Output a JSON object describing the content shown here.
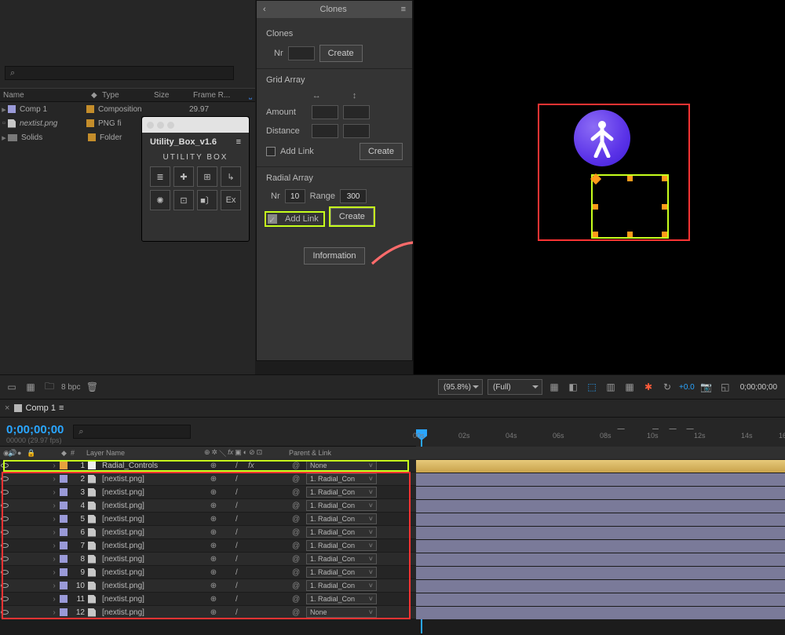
{
  "projectPanel": {
    "searchIcon": "⌕",
    "headers": {
      "name": "Name",
      "type": "Type",
      "size": "Size",
      "frame": "Frame R..."
    },
    "rows": [
      {
        "name": "Comp 1",
        "type": "Composition",
        "frame": "29.97"
      },
      {
        "name": "nextist.png",
        "type": "PNG fi"
      },
      {
        "name": "Solids",
        "type": "Folder"
      }
    ],
    "bpc": "8 bpc"
  },
  "utilityBox": {
    "title": "Utility_Box_v1.6",
    "brand": "UTILITY BOX",
    "icons": [
      "≣",
      "✚",
      "⊞",
      "↳",
      "✺",
      "⊡",
      "■〕",
      "Ex"
    ]
  },
  "clones": {
    "panelTitle": "Clones",
    "sectionClones": "Clones",
    "nrLabel": "Nr",
    "createLabel": "Create",
    "gridArray": "Grid Array",
    "amount": "Amount",
    "distance": "Distance",
    "addLink": "Add Link",
    "radialArray": "Radial Array",
    "radialNrLabel": "Nr",
    "radialNr": "10",
    "rangeLabel": "Range",
    "range": "300",
    "information": "Information"
  },
  "viewerFooter": {
    "zoom": "(95.8%)",
    "quality": "(Full)",
    "timebox": "0;00;00;00",
    "exposure": "+0.0"
  },
  "tab": {
    "name": "Comp 1"
  },
  "timeline": {
    "timecode": "0;00;00;00",
    "sub": "00000 (29.97 fps)",
    "searchIcon": "⌕",
    "columns": {
      "num": "#",
      "layerName": "Layer Name",
      "parent": "Parent & Link"
    },
    "ticks": [
      "00s",
      "02s",
      "04s",
      "06s",
      "08s",
      "10s",
      "12s",
      "14s",
      "16"
    ]
  },
  "layers": [
    {
      "n": "1",
      "name": "Radial_Controls",
      "parent": "None",
      "color": "or",
      "shy": true
    },
    {
      "n": "2",
      "name": "[nextist.png]",
      "parent": "1. Radial_Con"
    },
    {
      "n": "3",
      "name": "[nextist.png]",
      "parent": "1. Radial_Con"
    },
    {
      "n": "4",
      "name": "[nextist.png]",
      "parent": "1. Radial_Con"
    },
    {
      "n": "5",
      "name": "[nextist.png]",
      "parent": "1. Radial_Con"
    },
    {
      "n": "6",
      "name": "[nextist.png]",
      "parent": "1. Radial_Con"
    },
    {
      "n": "7",
      "name": "[nextist.png]",
      "parent": "1. Radial_Con"
    },
    {
      "n": "8",
      "name": "[nextist.png]",
      "parent": "1. Radial_Con"
    },
    {
      "n": "9",
      "name": "[nextist.png]",
      "parent": "1. Radial_Con"
    },
    {
      "n": "10",
      "name": "[nextist.png]",
      "parent": "1. Radial_Con"
    },
    {
      "n": "11",
      "name": "[nextist.png]",
      "parent": "1. Radial_Con"
    },
    {
      "n": "12",
      "name": "[nextist.png]",
      "parent": "None"
    }
  ]
}
